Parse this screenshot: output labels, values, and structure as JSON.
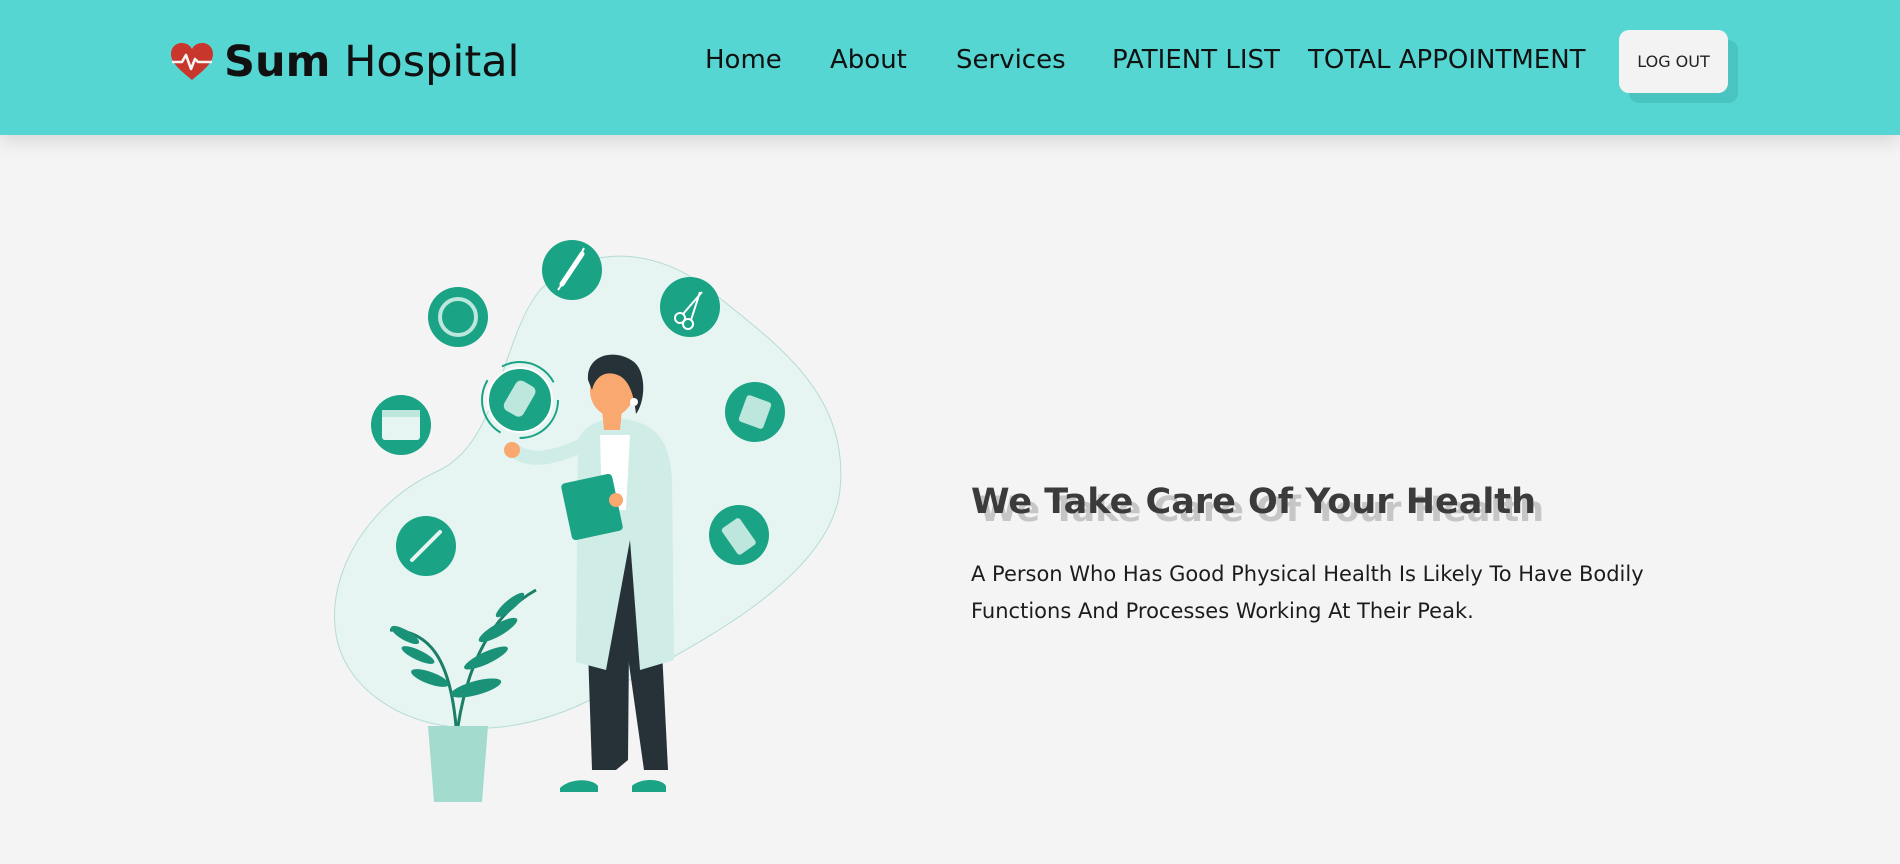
{
  "header": {
    "logo_bold": "Sum",
    "logo_light": "Hospital",
    "nav": [
      {
        "label": "Home"
      },
      {
        "label": "About"
      },
      {
        "label": "Services"
      },
      {
        "label": "PATIENT LIST"
      },
      {
        "label": "TOTAL APPOINTMENT"
      }
    ],
    "logout_label": "LOG OUT"
  },
  "hero": {
    "title": "We Take Care Of Your Health",
    "text": "A Person Who Has Good Physical Health Is Likely To Have Bodily Functions And Processes Working At Their Peak."
  },
  "colors": {
    "header_bg": "#56d6d3",
    "accent_green": "#1aa385",
    "heart_red": "#c9372c",
    "page_bg": "#f4f4f4"
  },
  "icons": [
    "heart-pulse-icon",
    "syringe-icon",
    "scissors-icon",
    "ring-icon",
    "bandage-icon",
    "notepad-icon",
    "calendar-icon",
    "pill-pack-icon",
    "thermometer-icon"
  ]
}
